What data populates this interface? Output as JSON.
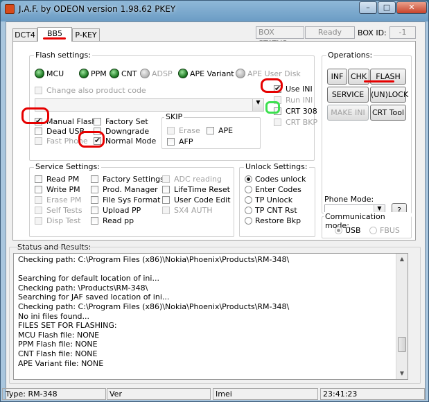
{
  "window": {
    "title": "J.A.F. by ODEON version 1.98.62 PKEY",
    "min_glyph": "–",
    "max_glyph": "□",
    "close_glyph": "✕"
  },
  "tabs": [
    {
      "label": "DCT4",
      "active": false
    },
    {
      "label": "BB5",
      "active": true
    },
    {
      "label": "P-KEY",
      "active": false
    }
  ],
  "box_status": {
    "label": "BOX STATUS:",
    "value": "Ready"
  },
  "box_id": {
    "label": "BOX ID:",
    "value": "-1"
  },
  "flash_settings": {
    "title": "Flash settings:",
    "leds": [
      {
        "label": "MCU",
        "enabled": true
      },
      {
        "label": "PPM",
        "enabled": true
      },
      {
        "label": "CNT",
        "enabled": true
      },
      {
        "label": "ADSP",
        "enabled": false
      },
      {
        "label": "APE Variant",
        "enabled": true
      },
      {
        "label": "APE User Disk",
        "enabled": false
      }
    ],
    "change_product_code": "Change also product code",
    "product_combo_value": "",
    "checks": [
      {
        "label": "Manual Flash",
        "checked": true,
        "enabled": true
      },
      {
        "label": "Factory Set",
        "checked": false,
        "enabled": true
      },
      {
        "label": "Dead USB",
        "checked": false,
        "enabled": true
      },
      {
        "label": "Downgrade",
        "checked": false,
        "enabled": true
      },
      {
        "label": "Fast Phone",
        "checked": false,
        "enabled": false
      },
      {
        "label": "Normal Mode",
        "checked": true,
        "enabled": true
      }
    ],
    "ini": [
      {
        "label": "Use INI",
        "checked": true,
        "enabled": true
      },
      {
        "label": "Run INI",
        "checked": false,
        "enabled": false
      },
      {
        "label": "CRT 308",
        "checked": false,
        "enabled": true
      },
      {
        "label": "CRT BKP",
        "checked": false,
        "enabled": false
      }
    ],
    "skip": {
      "title": "SKIP",
      "items": [
        {
          "label": "Erase",
          "checked": false,
          "enabled": false
        },
        {
          "label": "APE",
          "checked": false,
          "enabled": true
        },
        {
          "label": "AFP",
          "checked": false,
          "enabled": true
        }
      ]
    }
  },
  "service_settings": {
    "title": "Service Settings:",
    "col1": [
      {
        "label": "Read PM",
        "enabled": true
      },
      {
        "label": "Write PM",
        "enabled": true
      },
      {
        "label": "Erase PM",
        "enabled": false
      },
      {
        "label": "Self Tests",
        "enabled": false
      },
      {
        "label": "Disp Test",
        "enabled": false
      }
    ],
    "col2": [
      {
        "label": "Factory Settings",
        "enabled": true
      },
      {
        "label": "Prod. Manager",
        "enabled": true
      },
      {
        "label": "File Sys Format",
        "enabled": true
      },
      {
        "label": "Upload PP",
        "enabled": true
      },
      {
        "label": "Read pp",
        "enabled": true
      }
    ],
    "col3": [
      {
        "label": "ADC reading",
        "enabled": false
      },
      {
        "label": "LifeTime Reset",
        "enabled": true
      },
      {
        "label": "User Code Edit",
        "enabled": true
      },
      {
        "label": "SX4 AUTH",
        "enabled": false
      }
    ]
  },
  "unlock_settings": {
    "title": "Unlock Settings:",
    "options": [
      {
        "label": "Codes unlock",
        "selected": true
      },
      {
        "label": "Enter Codes",
        "selected": false
      },
      {
        "label": "TP Unlock",
        "selected": false
      },
      {
        "label": "TP CNT Rst",
        "selected": false
      },
      {
        "label": "Restore Bkp",
        "selected": false
      }
    ]
  },
  "operations": {
    "title": "Operations:",
    "buttons": [
      {
        "label": "INF",
        "enabled": true
      },
      {
        "label": "CHK",
        "enabled": true
      },
      {
        "label": "FLASH",
        "enabled": true
      },
      {
        "label": "SERVICE",
        "enabled": true
      },
      {
        "label": "(UN)LOCK",
        "enabled": true
      },
      {
        "label": "MAKE INI",
        "enabled": false
      },
      {
        "label": "CRT Tool",
        "enabled": true
      }
    ]
  },
  "phone_mode": {
    "title": "Phone Mode:",
    "value": "",
    "help_label": "?"
  },
  "communication_mode": {
    "title": "Communication mode:",
    "options": [
      {
        "label": "USB",
        "selected": true
      },
      {
        "label": "FBUS",
        "selected": false
      }
    ]
  },
  "status": {
    "title": "Status and Results:",
    "lines": [
      "Checking path: C:\\Program Files (x86)\\Nokia\\Phoenix\\Products\\RM-348\\",
      "",
      "Searching for default location of ini...",
      "Checking path: \\Products\\RM-348\\",
      "Searching for JAF saved location of ini...",
      "Checking path: C:\\Program Files (x86)\\Nokia\\Phoenix\\Products\\RM-348\\",
      "No ini files found...",
      "FILES SET FOR FLASHING:",
      "MCU Flash file: NONE",
      "PPM Flash file: NONE",
      "CNT Flash file: NONE",
      "APE Variant file: NONE"
    ]
  },
  "statusbar": {
    "type": "Type: RM-348",
    "ver": "Ver",
    "imei": "Imei",
    "time": "23:41:23"
  },
  "annotation_colors": {
    "red": "#e60000",
    "green": "#3de050"
  }
}
